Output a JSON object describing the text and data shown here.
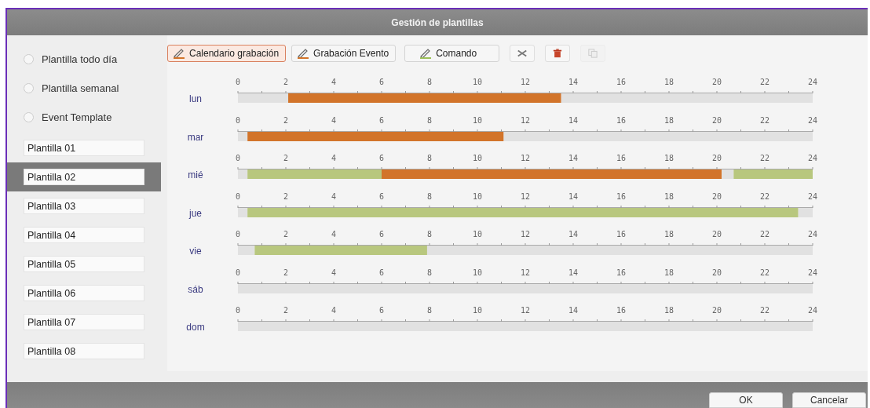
{
  "window": {
    "title": "Gestión de plantillas"
  },
  "template_types": [
    {
      "label": "Plantilla todo día",
      "selected": false
    },
    {
      "label": "Plantilla semanal",
      "selected": false
    },
    {
      "label": "Event Template",
      "selected": false
    }
  ],
  "templates": [
    {
      "label": "Plantilla 01",
      "selected": false
    },
    {
      "label": "Plantilla 02",
      "selected": true
    },
    {
      "label": "Plantilla 03",
      "selected": false
    },
    {
      "label": "Plantilla 04",
      "selected": false
    },
    {
      "label": "Plantilla 05",
      "selected": false
    },
    {
      "label": "Plantilla 06",
      "selected": false
    },
    {
      "label": "Plantilla 07",
      "selected": false
    },
    {
      "label": "Plantilla 08",
      "selected": false
    }
  ],
  "toolbar": [
    {
      "kind": "brush",
      "label": "Calendario grabación",
      "color": "#d2742a",
      "selected": true
    },
    {
      "kind": "brush",
      "label": "Grabación Evento",
      "color": "#d2742a",
      "selected": false
    },
    {
      "kind": "brush",
      "label": "Comando",
      "color": "#9cc05a",
      "selected": false
    },
    {
      "kind": "clear",
      "disabled": false
    },
    {
      "kind": "delete",
      "disabled": false
    },
    {
      "kind": "copy",
      "disabled": true
    }
  ],
  "days": [
    {
      "chart_data": {
        "type": "bar",
        "orientation": "horizontal",
        "stacked": true,
        "categories": [
          "lun"
        ],
        "xlim": [
          0,
          24
        ],
        "xticks": [
          0,
          2,
          4,
          6,
          8,
          10,
          12,
          14,
          16,
          18,
          20,
          22,
          24
        ],
        "series": [
          {
            "color": "#e1e1e1",
            "values": [
              2.1
            ]
          },
          {
            "color": "#d2742a",
            "values": [
              11.4
            ]
          },
          {
            "color": "#e1e1e1",
            "values": [
              10.5
            ]
          }
        ]
      }
    },
    {
      "chart_data": {
        "type": "bar",
        "orientation": "horizontal",
        "stacked": true,
        "categories": [
          "mar"
        ],
        "xlim": [
          0,
          24
        ],
        "xticks": [
          0,
          2,
          4,
          6,
          8,
          10,
          12,
          14,
          16,
          18,
          20,
          22,
          24
        ],
        "series": [
          {
            "color": "#e1e1e1",
            "values": [
              0.4
            ]
          },
          {
            "color": "#d2742a",
            "values": [
              10.7
            ]
          },
          {
            "color": "#e1e1e1",
            "values": [
              12.9
            ]
          }
        ]
      }
    },
    {
      "chart_data": {
        "type": "bar",
        "orientation": "horizontal",
        "stacked": true,
        "categories": [
          "mié"
        ],
        "xlim": [
          0,
          24
        ],
        "xticks": [
          0,
          2,
          4,
          6,
          8,
          10,
          12,
          14,
          16,
          18,
          20,
          22,
          24
        ],
        "series": [
          {
            "color": "#e1e1e1",
            "values": [
              0.4
            ]
          },
          {
            "color": "#b8c77e",
            "values": [
              5.6
            ]
          },
          {
            "color": "#d2742a",
            "values": [
              14.2
            ]
          },
          {
            "color": "#e1e1e1",
            "values": [
              0.5
            ]
          },
          {
            "color": "#b8c77e",
            "values": [
              3.3
            ]
          }
        ]
      }
    },
    {
      "chart_data": {
        "type": "bar",
        "orientation": "horizontal",
        "stacked": true,
        "categories": [
          "jue"
        ],
        "xlim": [
          0,
          24
        ],
        "xticks": [
          0,
          2,
          4,
          6,
          8,
          10,
          12,
          14,
          16,
          18,
          20,
          22,
          24
        ],
        "series": [
          {
            "color": "#e1e1e1",
            "values": [
              0.4
            ]
          },
          {
            "color": "#b8c77e",
            "values": [
              23
            ]
          },
          {
            "color": "#e1e1e1",
            "values": [
              0.6
            ]
          }
        ]
      }
    },
    {
      "chart_data": {
        "type": "bar",
        "orientation": "horizontal",
        "stacked": true,
        "categories": [
          "vie"
        ],
        "xlim": [
          0,
          24
        ],
        "xticks": [
          0,
          2,
          4,
          6,
          8,
          10,
          12,
          14,
          16,
          18,
          20,
          22,
          24
        ],
        "series": [
          {
            "color": "#e1e1e1",
            "values": [
              0.7
            ]
          },
          {
            "color": "#b8c77e",
            "values": [
              7.2
            ]
          },
          {
            "color": "#e1e1e1",
            "values": [
              16.1
            ]
          }
        ]
      }
    },
    {
      "chart_data": {
        "type": "bar",
        "orientation": "horizontal",
        "stacked": true,
        "categories": [
          "sáb"
        ],
        "xlim": [
          0,
          24
        ],
        "xticks": [
          0,
          2,
          4,
          6,
          8,
          10,
          12,
          14,
          16,
          18,
          20,
          22,
          24
        ],
        "series": [
          {
            "color": "#e1e1e1",
            "values": [
              24
            ]
          }
        ]
      }
    },
    {
      "chart_data": {
        "type": "bar",
        "orientation": "horizontal",
        "stacked": true,
        "categories": [
          "dom"
        ],
        "xlim": [
          0,
          24
        ],
        "xticks": [
          0,
          2,
          4,
          6,
          8,
          10,
          12,
          14,
          16,
          18,
          20,
          22,
          24
        ],
        "series": [
          {
            "color": "#e1e1e1",
            "values": [
              24
            ]
          }
        ]
      }
    }
  ],
  "buttons": [
    {
      "label": "OK"
    },
    {
      "label": "Cancelar"
    }
  ]
}
